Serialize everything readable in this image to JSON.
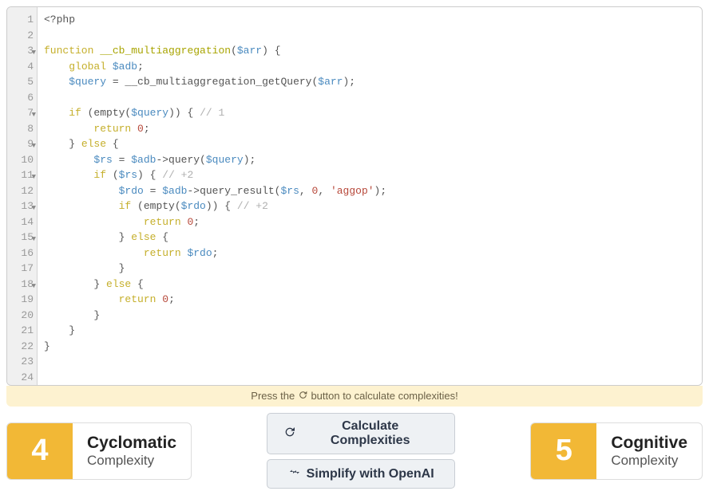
{
  "code": {
    "lines": [
      {
        "n": 1,
        "fold": false,
        "content": [
          {
            "t": "p",
            "v": "<?php"
          }
        ]
      },
      {
        "n": 2,
        "fold": false,
        "content": []
      },
      {
        "n": 3,
        "fold": true,
        "content": [
          {
            "t": "k",
            "v": "function"
          },
          {
            "t": "p",
            "v": " "
          },
          {
            "t": "fn",
            "v": "__cb_multiaggregation"
          },
          {
            "t": "p",
            "v": "("
          },
          {
            "t": "v",
            "v": "$arr"
          },
          {
            "t": "p",
            "v": ") {"
          }
        ]
      },
      {
        "n": 4,
        "fold": false,
        "content": [
          {
            "t": "p",
            "v": "    "
          },
          {
            "t": "k",
            "v": "global"
          },
          {
            "t": "p",
            "v": " "
          },
          {
            "t": "v",
            "v": "$adb"
          },
          {
            "t": "p",
            "v": ";"
          }
        ]
      },
      {
        "n": 5,
        "fold": false,
        "content": [
          {
            "t": "p",
            "v": "    "
          },
          {
            "t": "v",
            "v": "$query"
          },
          {
            "t": "p",
            "v": " = __cb_multiaggregation_getQuery("
          },
          {
            "t": "v",
            "v": "$arr"
          },
          {
            "t": "p",
            "v": ");"
          }
        ]
      },
      {
        "n": 6,
        "fold": false,
        "content": []
      },
      {
        "n": 7,
        "fold": true,
        "content": [
          {
            "t": "p",
            "v": "    "
          },
          {
            "t": "k",
            "v": "if"
          },
          {
            "t": "p",
            "v": " (empty("
          },
          {
            "t": "v",
            "v": "$query"
          },
          {
            "t": "p",
            "v": ")) { "
          },
          {
            "t": "c",
            "v": "// 1"
          }
        ]
      },
      {
        "n": 8,
        "fold": false,
        "content": [
          {
            "t": "p",
            "v": "        "
          },
          {
            "t": "k",
            "v": "return"
          },
          {
            "t": "p",
            "v": " "
          },
          {
            "t": "n",
            "v": "0"
          },
          {
            "t": "p",
            "v": ";"
          }
        ]
      },
      {
        "n": 9,
        "fold": true,
        "content": [
          {
            "t": "p",
            "v": "    } "
          },
          {
            "t": "k",
            "v": "else"
          },
          {
            "t": "p",
            "v": " {"
          }
        ]
      },
      {
        "n": 10,
        "fold": false,
        "content": [
          {
            "t": "p",
            "v": "        "
          },
          {
            "t": "v",
            "v": "$rs"
          },
          {
            "t": "p",
            "v": " = "
          },
          {
            "t": "v",
            "v": "$adb"
          },
          {
            "t": "p",
            "v": "->query("
          },
          {
            "t": "v",
            "v": "$query"
          },
          {
            "t": "p",
            "v": ");"
          }
        ]
      },
      {
        "n": 11,
        "fold": true,
        "content": [
          {
            "t": "p",
            "v": "        "
          },
          {
            "t": "k",
            "v": "if"
          },
          {
            "t": "p",
            "v": " ("
          },
          {
            "t": "v",
            "v": "$rs"
          },
          {
            "t": "p",
            "v": ") { "
          },
          {
            "t": "c",
            "v": "// +2"
          }
        ]
      },
      {
        "n": 12,
        "fold": false,
        "content": [
          {
            "t": "p",
            "v": "            "
          },
          {
            "t": "v",
            "v": "$rdo"
          },
          {
            "t": "p",
            "v": " = "
          },
          {
            "t": "v",
            "v": "$adb"
          },
          {
            "t": "p",
            "v": "->query_result("
          },
          {
            "t": "v",
            "v": "$rs"
          },
          {
            "t": "p",
            "v": ", "
          },
          {
            "t": "n",
            "v": "0"
          },
          {
            "t": "p",
            "v": ", "
          },
          {
            "t": "s",
            "v": "'aggop'"
          },
          {
            "t": "p",
            "v": ");"
          }
        ]
      },
      {
        "n": 13,
        "fold": true,
        "content": [
          {
            "t": "p",
            "v": "            "
          },
          {
            "t": "k",
            "v": "if"
          },
          {
            "t": "p",
            "v": " (empty("
          },
          {
            "t": "v",
            "v": "$rdo"
          },
          {
            "t": "p",
            "v": ")) { "
          },
          {
            "t": "c",
            "v": "// +2"
          }
        ]
      },
      {
        "n": 14,
        "fold": false,
        "content": [
          {
            "t": "p",
            "v": "                "
          },
          {
            "t": "k",
            "v": "return"
          },
          {
            "t": "p",
            "v": " "
          },
          {
            "t": "n",
            "v": "0"
          },
          {
            "t": "p",
            "v": ";"
          }
        ]
      },
      {
        "n": 15,
        "fold": true,
        "content": [
          {
            "t": "p",
            "v": "            } "
          },
          {
            "t": "k",
            "v": "else"
          },
          {
            "t": "p",
            "v": " {"
          }
        ]
      },
      {
        "n": 16,
        "fold": false,
        "content": [
          {
            "t": "p",
            "v": "                "
          },
          {
            "t": "k",
            "v": "return"
          },
          {
            "t": "p",
            "v": " "
          },
          {
            "t": "v",
            "v": "$rdo"
          },
          {
            "t": "p",
            "v": ";"
          }
        ]
      },
      {
        "n": 17,
        "fold": false,
        "content": [
          {
            "t": "p",
            "v": "            }"
          }
        ]
      },
      {
        "n": 18,
        "fold": true,
        "content": [
          {
            "t": "p",
            "v": "        } "
          },
          {
            "t": "k",
            "v": "else"
          },
          {
            "t": "p",
            "v": " {"
          }
        ]
      },
      {
        "n": 19,
        "fold": false,
        "content": [
          {
            "t": "p",
            "v": "            "
          },
          {
            "t": "k",
            "v": "return"
          },
          {
            "t": "p",
            "v": " "
          },
          {
            "t": "n",
            "v": "0"
          },
          {
            "t": "p",
            "v": ";"
          }
        ]
      },
      {
        "n": 20,
        "fold": false,
        "content": [
          {
            "t": "p",
            "v": "        }"
          }
        ]
      },
      {
        "n": 21,
        "fold": false,
        "content": [
          {
            "t": "p",
            "v": "    }"
          }
        ]
      },
      {
        "n": 22,
        "fold": false,
        "content": [
          {
            "t": "p",
            "v": "}"
          }
        ]
      },
      {
        "n": 23,
        "fold": false,
        "content": []
      },
      {
        "n": 24,
        "fold": false,
        "content": []
      }
    ]
  },
  "hint": {
    "pre": "Press the ",
    "post": " button to calculate complexities!"
  },
  "cyclomatic": {
    "score": "4",
    "title": "Cyclomatic",
    "sub": "Complexity"
  },
  "cognitive": {
    "score": "5",
    "title": "Cognitive",
    "sub": "Complexity"
  },
  "buttons": {
    "calc": "Calculate Complexities",
    "simplify": "Simplify with OpenAI"
  }
}
